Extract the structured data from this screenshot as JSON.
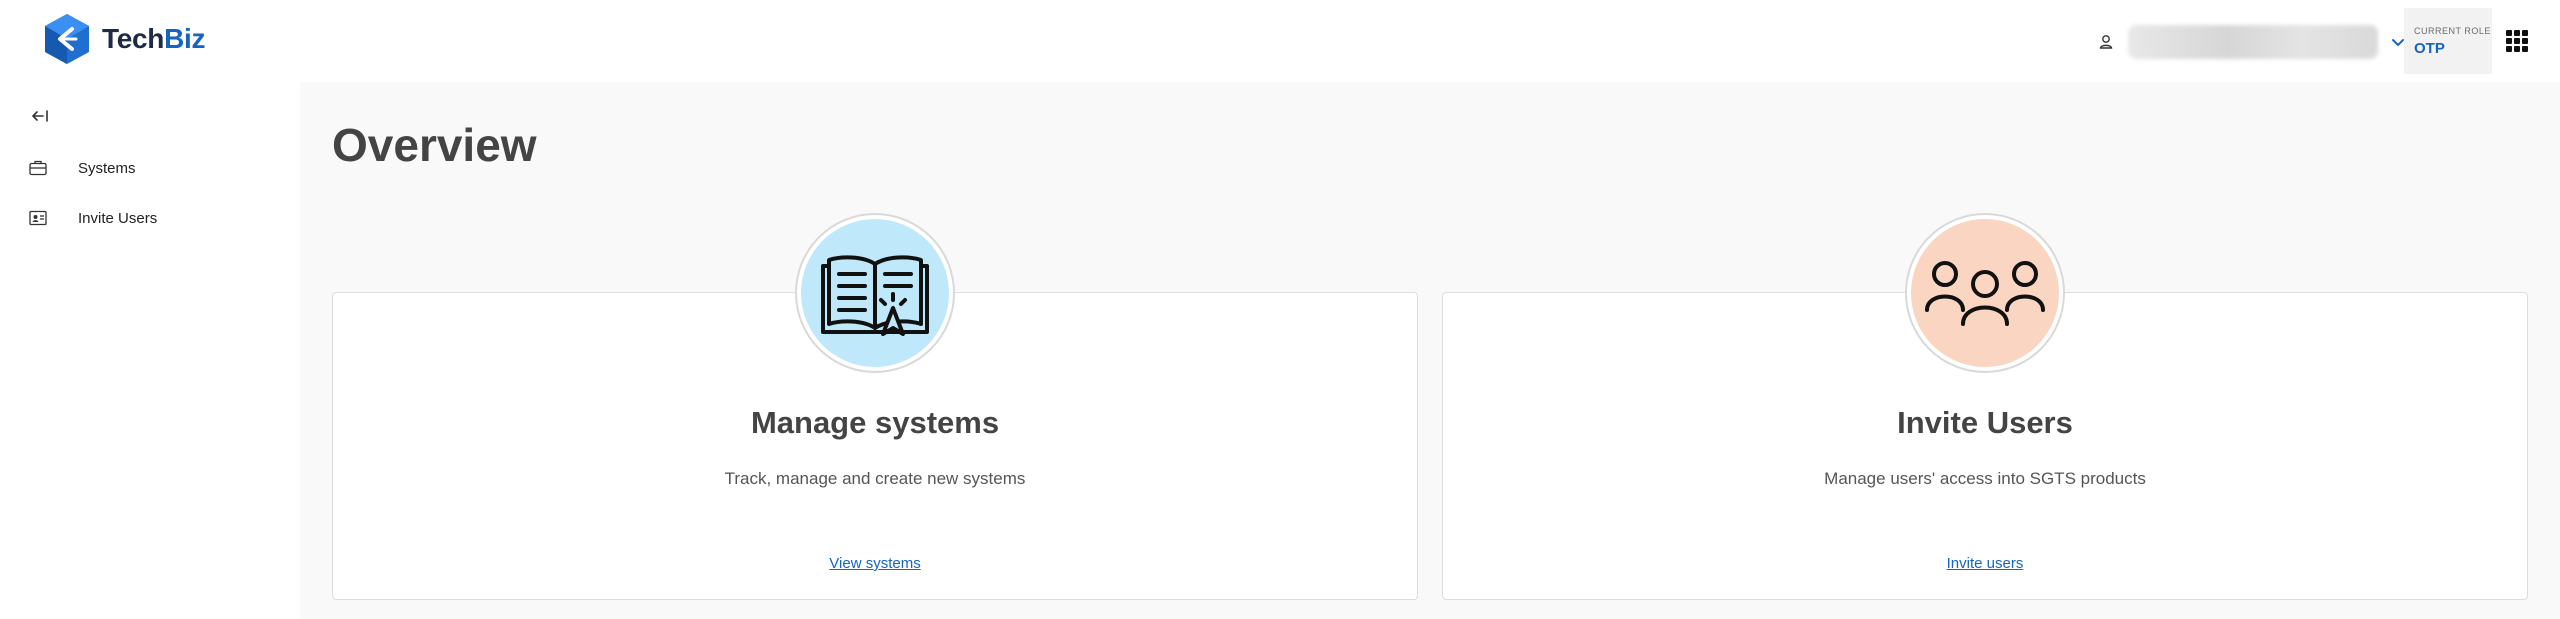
{
  "app": {
    "brand_prefix": "Tech",
    "brand_suffix": "Biz"
  },
  "header": {
    "role_label": "CURRENT ROLE",
    "role_value": "OTP",
    "icons": [
      "user-icon",
      "chevron-down-icon",
      "apps-grid-icon"
    ]
  },
  "sidebar": {
    "collapse_icon": "arrow-left-bar-icon",
    "items": [
      {
        "label": "Systems",
        "icon": "briefcase-icon"
      },
      {
        "label": "Invite Users",
        "icon": "contact-card-icon"
      }
    ]
  },
  "main": {
    "title": "Overview",
    "cards": [
      {
        "title": "Manage systems",
        "description": "Track, manage and create new systems",
        "link": "View systems",
        "icon": "book-cursor-icon",
        "circle_color": "#bfe8fb"
      },
      {
        "title": "Invite Users",
        "description": "Manage users' access into SGTS products",
        "link": "Invite users",
        "icon": "group-users-icon",
        "circle_color": "#f9d5c2"
      }
    ]
  },
  "colors": {
    "accent": "#1565c0",
    "main_bg": "#f9f9f9",
    "title": "#444444"
  }
}
